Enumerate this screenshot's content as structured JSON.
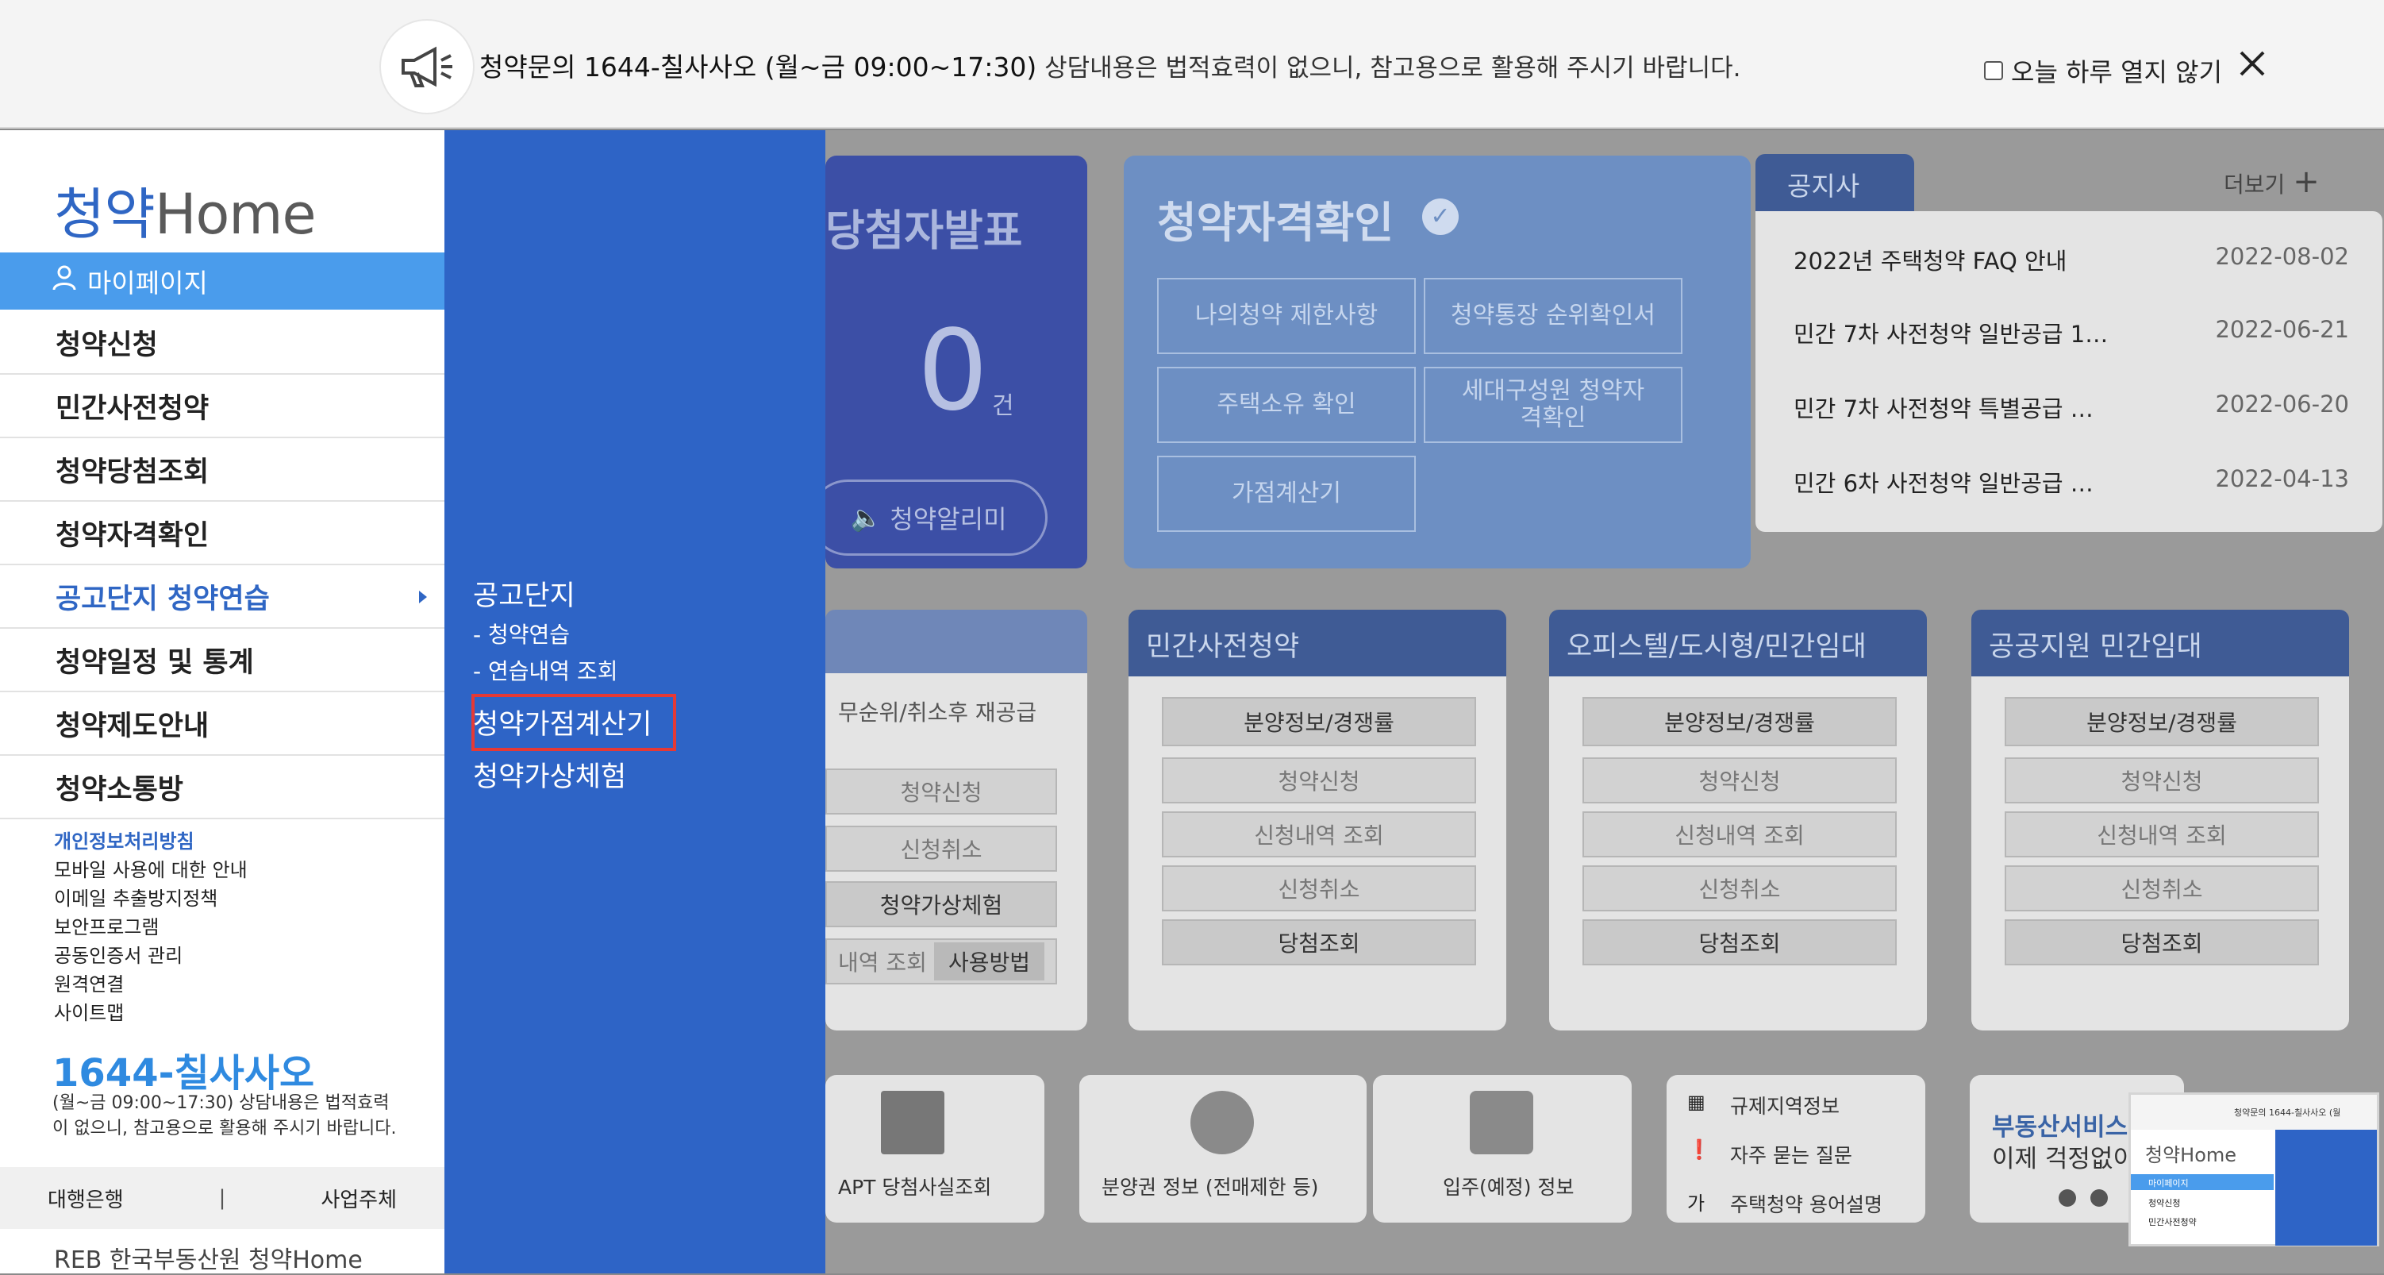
{
  "banner": {
    "phone_text": "청약문의 1644-칠사사오 (월~금 09:00~17:30)",
    "notice_text": "상담내용은 법적효력이 없으니, 참고용으로 활용해 주시기 바랍니다.",
    "noshow_label": "오늘 하루 열지 않기",
    "icons": {
      "megaphone": "megaphone-icon",
      "close": "close-icon"
    }
  },
  "sidebar": {
    "logo_prefix": "청약",
    "logo_suffix": "Home",
    "mypage": "마이페이지",
    "menu": [
      "청약신청",
      "민간사전청약",
      "청약당첨조회",
      "청약자격확인",
      "공고단지 청약연습",
      "청약일정 및 통계",
      "청약제도안내",
      "청약소통방"
    ],
    "links": [
      "개인정보처리방침",
      "모바일 사용에 대한 안내",
      "이메일 추출방지정책",
      "보안프로그램",
      "공동인증서 관리",
      "원격연결",
      "사이트맵"
    ],
    "phone": "1644-칠사사오",
    "phone_sub": "(월~금 09:00~17:30) 상담내용은 법적효력이 없으니, 참고용으로 활용해 주시기 바랍니다.",
    "bottom": [
      "대행은행",
      "사업주체"
    ],
    "footer": "REB 한국부동산원 청약Home"
  },
  "submenu": {
    "group_title": "공고단지",
    "items": [
      "- 청약연습",
      "- 연습내역 조회"
    ],
    "calc": "청약가점계산기",
    "virtual": "청약가상체험"
  },
  "main": {
    "winner": {
      "title": "당첨자발표",
      "count": "0",
      "unit": "건",
      "alarm": "청약알리미"
    },
    "qual": {
      "title": "청약자격확인",
      "buttons": [
        "나의청약 제한사항",
        "청약통장 순위확인서",
        "주택소유 확인",
        "세대구성원 청약자격확인",
        "가점계산기"
      ]
    },
    "notice": {
      "tab": "공지사항",
      "more": "더보기",
      "rows": [
        {
          "title": "2022년 주택청약 FAQ 안내",
          "date": "2022-08-02"
        },
        {
          "title": "민간 7차 사전청약 일반공급 1…",
          "date": "2022-06-21"
        },
        {
          "title": "민간 7차 사전청약 특별공급 …",
          "date": "2022-06-20"
        },
        {
          "title": "민간 6차 사전청약 일반공급 …",
          "date": "2022-04-13"
        }
      ]
    },
    "apt": {
      "sub": "무순위/취소후 재공급",
      "btns": [
        "청약신청",
        "신청취소",
        "청약가상체험"
      ],
      "mini": [
        "내역 조회",
        "사용방법"
      ]
    },
    "cats": [
      {
        "title": "민간사전청약",
        "btns": [
          "분양정보/경쟁률",
          "청약신청",
          "신청내역 조회",
          "신청취소",
          "당첨조회"
        ]
      },
      {
        "title": "오피스텔/도시형/민간임대",
        "btns": [
          "분양정보/경쟁률",
          "청약신청",
          "신청내역 조회",
          "신청취소",
          "당첨조회"
        ]
      },
      {
        "title": "공공지원 민간임대",
        "btns": [
          "분양정보/경쟁률",
          "청약신청",
          "신청내역 조회",
          "신청취소",
          "당첨조회"
        ]
      }
    ],
    "quick": [
      "APT 당첨사실조회",
      "분양권 정보 (전매제한 등)",
      "입주(예정) 정보"
    ],
    "info": [
      "규제지역정보",
      "자주 묻는 질문",
      "주택청약 용어설명"
    ],
    "promo": {
      "line1": "부동산서비스!!",
      "line2": "이제 걱정없이"
    }
  },
  "thumb": {
    "notice": "청약문의 1644-칠사사오 (월",
    "logo": "청약Home",
    "items": [
      "마이페이지",
      "청약신청",
      "민간사전청약"
    ]
  }
}
